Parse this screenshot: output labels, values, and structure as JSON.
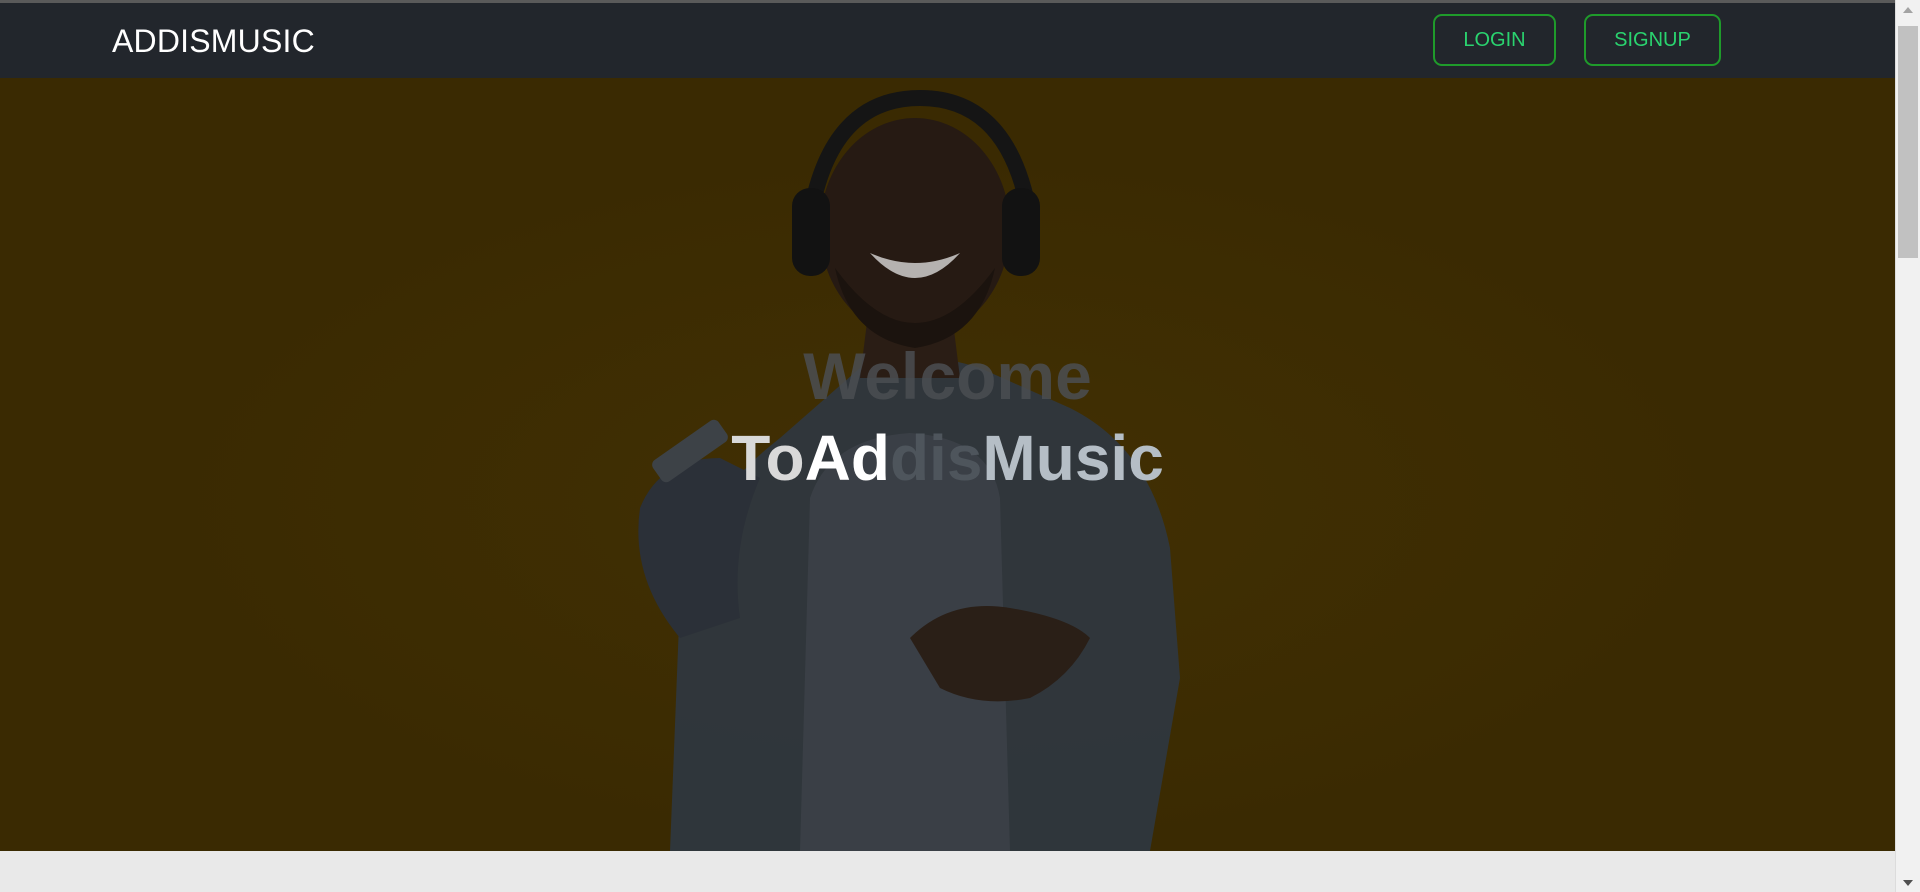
{
  "navbar": {
    "brand": "ADDISMUSIC",
    "login_label": "LOGIN",
    "signup_label": "SIGNUP"
  },
  "hero": {
    "title": "Welcome",
    "subtitle_parts": {
      "part1": "To",
      "part2": "Ad",
      "part3": "dis",
      "part4": "Music"
    }
  },
  "colors": {
    "navbar_bg": "#22262c",
    "accent_border": "#1f9b2b",
    "accent_text": "#2ad36f",
    "hero_bg": "#3a2a02"
  },
  "icons": {
    "scroll_up": "scroll-up-arrow-icon",
    "scroll_down": "scroll-down-arrow-icon"
  }
}
